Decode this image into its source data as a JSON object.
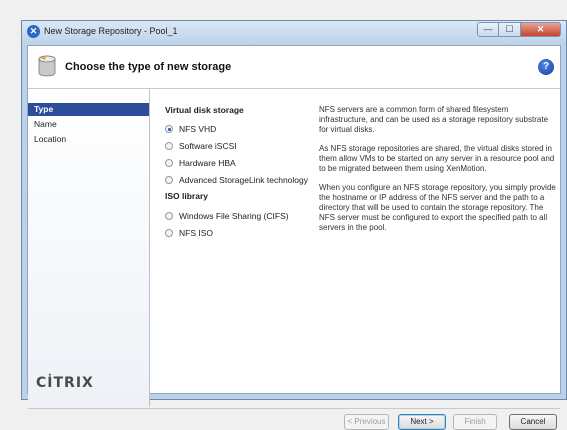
{
  "window": {
    "title": "New Storage Repository - Pool_1",
    "controls": {
      "minimize": "—",
      "maximize": "☐",
      "close": "✕"
    }
  },
  "header": {
    "title": "Choose the type of new storage",
    "help": "?"
  },
  "sidebar": {
    "items": [
      {
        "label": "Type",
        "active": true
      },
      {
        "label": "Name",
        "active": false
      },
      {
        "label": "Location",
        "active": false
      }
    ],
    "logo": "CİTRIX"
  },
  "content": {
    "virtual_disk_title": "Virtual disk storage",
    "virtual_disk_options": [
      {
        "label": "NFS VHD",
        "checked": true
      },
      {
        "label": "Software iSCSI",
        "checked": false
      },
      {
        "label": "Hardware HBA",
        "checked": false
      },
      {
        "label": "Advanced StorageLink technology",
        "checked": false
      }
    ],
    "iso_title": "ISO library",
    "iso_options": [
      {
        "label": "Windows File Sharing (CIFS)",
        "checked": false
      },
      {
        "label": "NFS ISO",
        "checked": false
      }
    ],
    "description": [
      "NFS servers are a common form of shared filesystem infrastructure, and can be used as a storage repository substrate for virtual disks.",
      "As NFS storage repositories are shared, the virtual disks stored in them allow VMs to be started on any server in a resource pool and to be migrated between them using XenMotion.",
      "When you configure an NFS storage repository, you simply provide the hostname or IP address of the NFS server and the path to a directory that will be used to contain the storage repository. The NFS server must be configured to export the specified path to all servers in the pool."
    ]
  },
  "footer": {
    "previous": "< Previous",
    "next": "Next >",
    "finish": "Finish",
    "cancel": "Cancel"
  },
  "colors": {
    "accent": "#2b4d9a",
    "window_frame": "#bcd2ea"
  }
}
